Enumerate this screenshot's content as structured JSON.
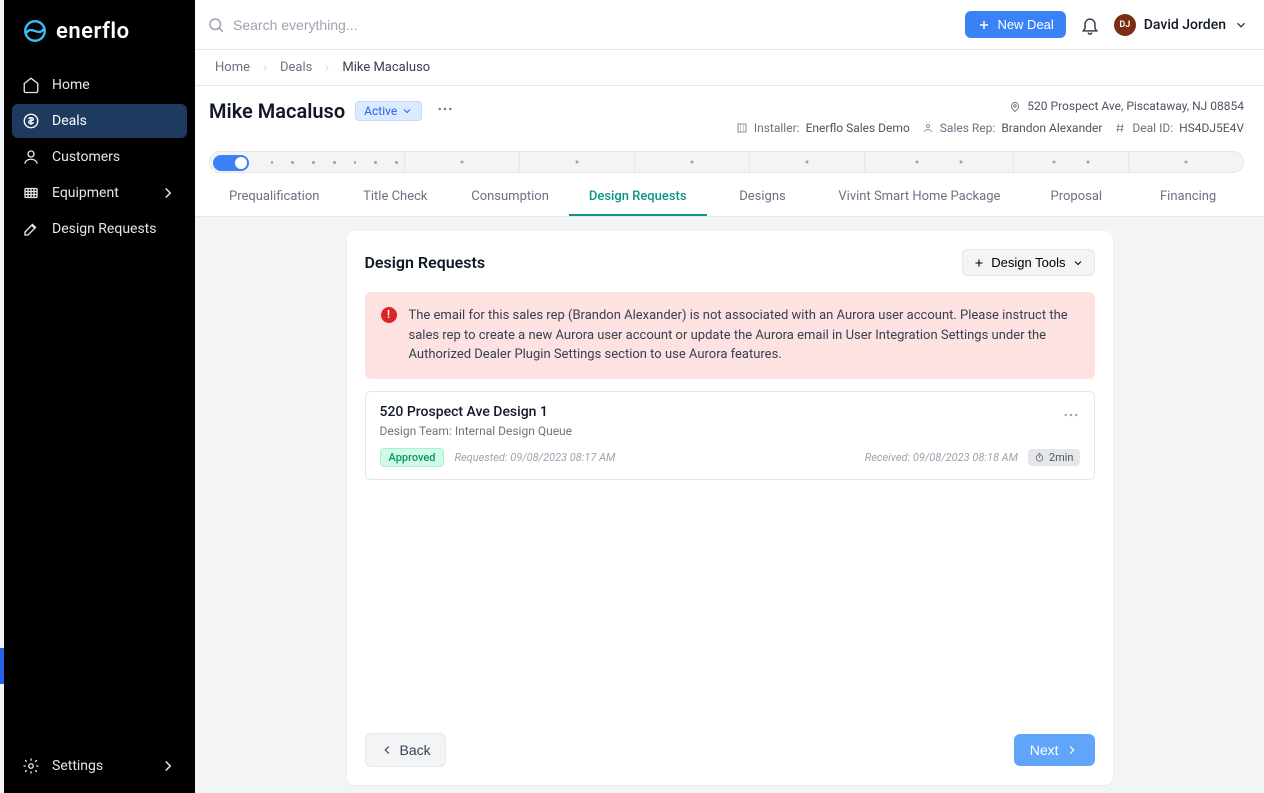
{
  "brand": "enerflo",
  "sidebar": {
    "items": [
      {
        "label": "Home"
      },
      {
        "label": "Deals"
      },
      {
        "label": "Customers"
      },
      {
        "label": "Equipment"
      },
      {
        "label": "Design Requests"
      }
    ],
    "footer": {
      "label": "Settings"
    }
  },
  "topbar": {
    "search_placeholder": "Search everything...",
    "new_deal_label": "New Deal",
    "user": {
      "initials": "DJ",
      "name": "David Jorden"
    }
  },
  "breadcrumbs": {
    "items": [
      "Home",
      "Deals",
      "Mike Macaluso"
    ]
  },
  "header": {
    "title": "Mike Macaluso",
    "status": "Active",
    "address": "520 Prospect Ave, Piscataway, NJ 08854",
    "installer_label": "Installer:",
    "installer": "Enerflo Sales Demo",
    "salesrep_label": "Sales Rep:",
    "salesrep": "Brandon Alexander",
    "dealid_label": "Deal ID:",
    "dealid": "HS4DJ5E4V"
  },
  "tabs": [
    "Prequalification",
    "Title Check",
    "Consumption",
    "Design Requests",
    "Designs",
    "Vivint Smart Home Package",
    "Proposal",
    "Financing"
  ],
  "active_tab_index": 3,
  "panel": {
    "title": "Design Requests",
    "tools_label": "Design Tools",
    "alert": "The email for this sales rep (Brandon Alexander) is not associated with an Aurora user account. Please instruct the sales rep to create a new Aurora user account or update the Aurora email in User Integration Settings under the Authorized Dealer Plugin Settings section to use Aurora features.",
    "request": {
      "title": "520 Prospect Ave Design 1",
      "team_line": "Design Team: Internal Design Queue",
      "status": "Approved",
      "requested": "Requested: 09/08/2023 08:17 AM",
      "received": "Received: 09/08/2023 08:18 AM",
      "duration": "2min"
    },
    "back_label": "Back",
    "next_label": "Next"
  }
}
